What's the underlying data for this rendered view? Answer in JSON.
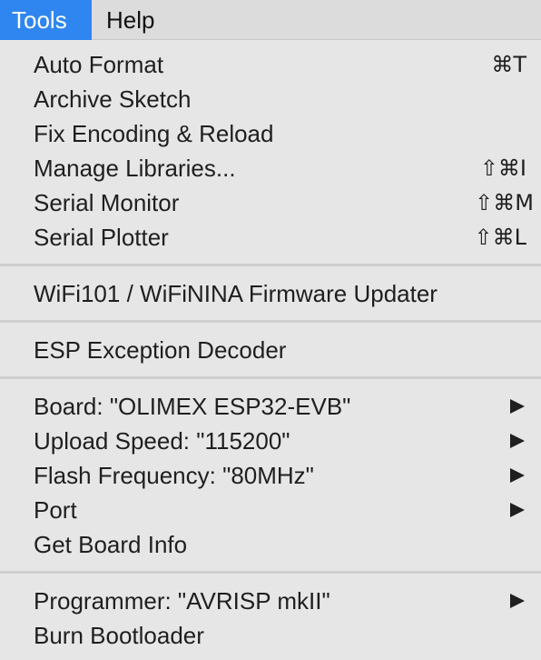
{
  "menubar": {
    "tools": "Tools",
    "help": "Help"
  },
  "menu": {
    "auto_format": {
      "label": "Auto Format",
      "shortcut": "⌘T"
    },
    "archive_sketch": {
      "label": "Archive Sketch"
    },
    "fix_encoding": {
      "label": "Fix Encoding & Reload"
    },
    "manage_libraries": {
      "label": "Manage Libraries...",
      "shortcut": "⇧⌘I"
    },
    "serial_monitor": {
      "label": "Serial Monitor",
      "shortcut": "⇧⌘M"
    },
    "serial_plotter": {
      "label": "Serial Plotter",
      "shortcut": "⇧⌘L"
    },
    "firmware_updater": {
      "label": "WiFi101 / WiFiNINA Firmware Updater"
    },
    "esp_exception": {
      "label": "ESP Exception Decoder"
    },
    "board": {
      "label": "Board: \"OLIMEX ESP32-EVB\""
    },
    "upload_speed": {
      "label": "Upload Speed: \"115200\""
    },
    "flash_frequency": {
      "label": "Flash Frequency: \"80MHz\""
    },
    "port": {
      "label": "Port"
    },
    "get_board_info": {
      "label": "Get Board Info"
    },
    "programmer": {
      "label": "Programmer: \"AVRISP mkII\""
    },
    "burn_bootloader": {
      "label": "Burn Bootloader"
    }
  }
}
